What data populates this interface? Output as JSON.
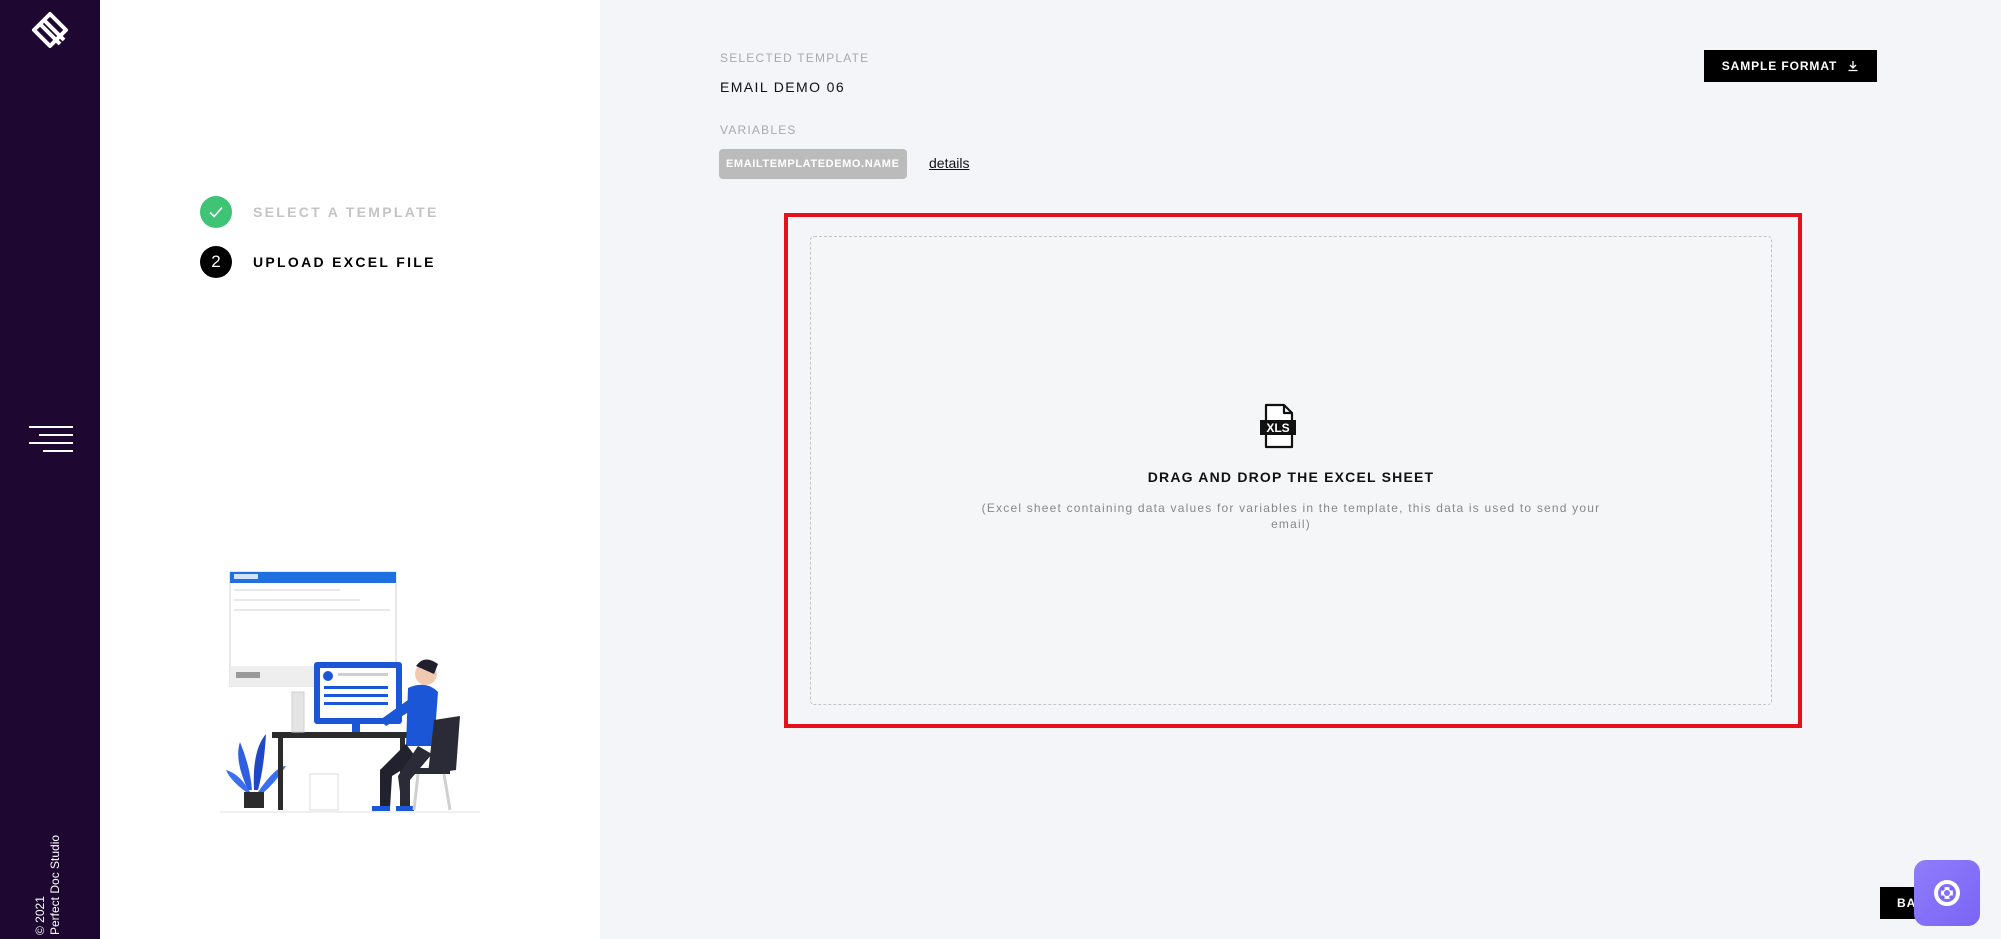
{
  "sidebar": {
    "logo": "perfect-doc-studio-logo",
    "menu_icon": "hamburger-menu-icon",
    "copyright_line1": "© 2021",
    "copyright_line2": "Perfect Doc Studio"
  },
  "steps": [
    {
      "label": "SELECT A TEMPLATE",
      "status": "done",
      "icon": "check-icon"
    },
    {
      "label": "UPLOAD EXCEL FILE",
      "status": "active",
      "number": "2"
    }
  ],
  "illustration": "person-at-computer-illustration",
  "main": {
    "selected_template_caption": "SELECTED TEMPLATE",
    "selected_template": "EMAIL DEMO 06",
    "variables_caption": "VARIABLES",
    "variable_chip": "EMAILTEMPLATEDEMO.NAME",
    "details_link": "details",
    "sample_format_label": "SAMPLE FORMAT",
    "sample_format_icon": "download-icon"
  },
  "dropzone": {
    "icon": "xls-file-icon",
    "title": "DRAG AND DROP THE EXCEL SHEET",
    "subtitle": "(Excel sheet containing data values for variables in the template, this data is used to send your email)"
  },
  "back_button_label": "BACK",
  "help_icon": "lifebuoy-help-icon",
  "colors": {
    "sidebar_bg": "#1e0832",
    "success": "#3fc476",
    "highlight": "#e5101a",
    "help_button": "#8f7dfb"
  }
}
